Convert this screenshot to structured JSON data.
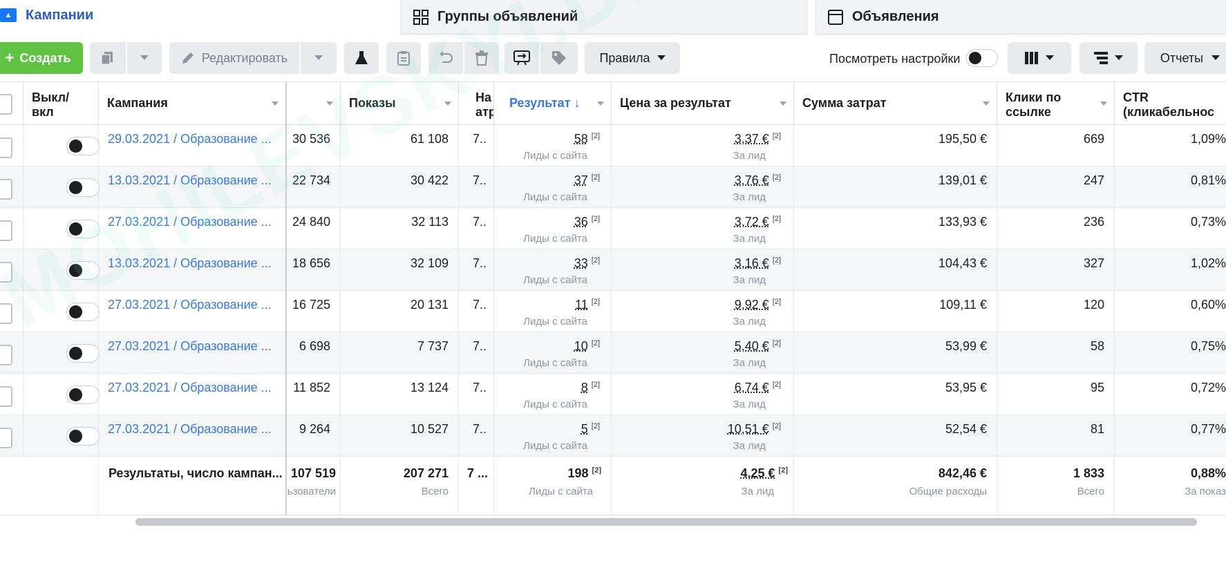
{
  "tabs": {
    "campaigns": "Кампании",
    "adsets": "Группы объявлений",
    "ads": "Объявления"
  },
  "toolbar": {
    "create": "Создать",
    "edit": "Редактировать",
    "rules": "Правила",
    "view_settings": "Посмотреть настройки",
    "reports": "Отчеты"
  },
  "columns": {
    "toggle": "Выкл/ вкл",
    "campaign": "Кампания",
    "reach": "",
    "impressions": "Показы",
    "attribution": "На атр",
    "result": "Результат ↓",
    "cost_per_result": "Цена за результат",
    "amount_spent": "Сумма затрат",
    "link_clicks": "Клики по ссылке",
    "ctr": "CTR (кликабельнос"
  },
  "rows": [
    {
      "name": "29.03.2021 / Образование ...",
      "reach": "30 536",
      "impressions": "61 108",
      "attr": "7..",
      "result": "58",
      "result_sub": "Лиды с сайта",
      "cpr": "3,37 €",
      "cpr_sub": "За лид",
      "spent": "195,50 €",
      "clicks": "669",
      "ctr": "1,09%"
    },
    {
      "name": "13.03.2021 / Образование ...",
      "reach": "22 734",
      "impressions": "30 422",
      "attr": "7..",
      "result": "37",
      "result_sub": "Лиды с сайта",
      "cpr": "3,76 €",
      "cpr_sub": "За лид",
      "spent": "139,01 €",
      "clicks": "247",
      "ctr": "0,81%"
    },
    {
      "name": "27.03.2021 / Образование ...",
      "reach": "24 840",
      "impressions": "32 113",
      "attr": "7..",
      "result": "36",
      "result_sub": "Лиды с сайта",
      "cpr": "3,72 €",
      "cpr_sub": "За лид",
      "spent": "133,93 €",
      "clicks": "236",
      "ctr": "0,73%"
    },
    {
      "name": "13.03.2021 / Образование ...",
      "reach": "18 656",
      "impressions": "32 109",
      "attr": "7..",
      "result": "33",
      "result_sub": "Лиды с сайта",
      "cpr": "3,16 €",
      "cpr_sub": "За лид",
      "spent": "104,43 €",
      "clicks": "327",
      "ctr": "1,02%"
    },
    {
      "name": "27.03.2021 / Образование ...",
      "reach": "16 725",
      "impressions": "20 131",
      "attr": "7..",
      "result": "11",
      "result_sub": "Лиды с сайта",
      "cpr": "9,92 €",
      "cpr_sub": "За лид",
      "spent": "109,11 €",
      "clicks": "120",
      "ctr": "0,60%"
    },
    {
      "name": "27.03.2021 / Образование ...",
      "reach": "6 698",
      "impressions": "7 737",
      "attr": "7..",
      "result": "10",
      "result_sub": "Лиды с сайта",
      "cpr": "5,40 €",
      "cpr_sub": "За лид",
      "spent": "53,99 €",
      "clicks": "58",
      "ctr": "0,75%"
    },
    {
      "name": "27.03.2021 / Образование ...",
      "reach": "11 852",
      "impressions": "13 124",
      "attr": "7..",
      "result": "8",
      "result_sub": "Лиды с сайта",
      "cpr": "6,74 €",
      "cpr_sub": "За лид",
      "spent": "53,95 €",
      "clicks": "95",
      "ctr": "0,72%"
    },
    {
      "name": "27.03.2021 / Образование ...",
      "reach": "9 264",
      "impressions": "10 527",
      "attr": "7..",
      "result": "5",
      "result_sub": "Лиды с сайта",
      "cpr": "10,51 €",
      "cpr_sub": "За лид",
      "spent": "52,54 €",
      "clicks": "81",
      "ctr": "0,77%"
    }
  ],
  "totals": {
    "name": "Результаты, число кампан...",
    "reach": "107 519",
    "reach_sub": "ьзователи",
    "impressions": "207 271",
    "impressions_sub": "Всего",
    "attr": "7 ...",
    "result": "198",
    "result_sub": "Лиды с сайта",
    "cpr": "4,25 €",
    "cpr_sub": "За лид",
    "spent": "842,46 €",
    "spent_sub": "Общие расходы",
    "clicks": "1 833",
    "clicks_sub": "Всего",
    "ctr": "0,88%",
    "ctr_sub": "За показ"
  },
  "footnote_mark": "[2]",
  "watermark": "MOHILEVSKYI.DIGITAL"
}
